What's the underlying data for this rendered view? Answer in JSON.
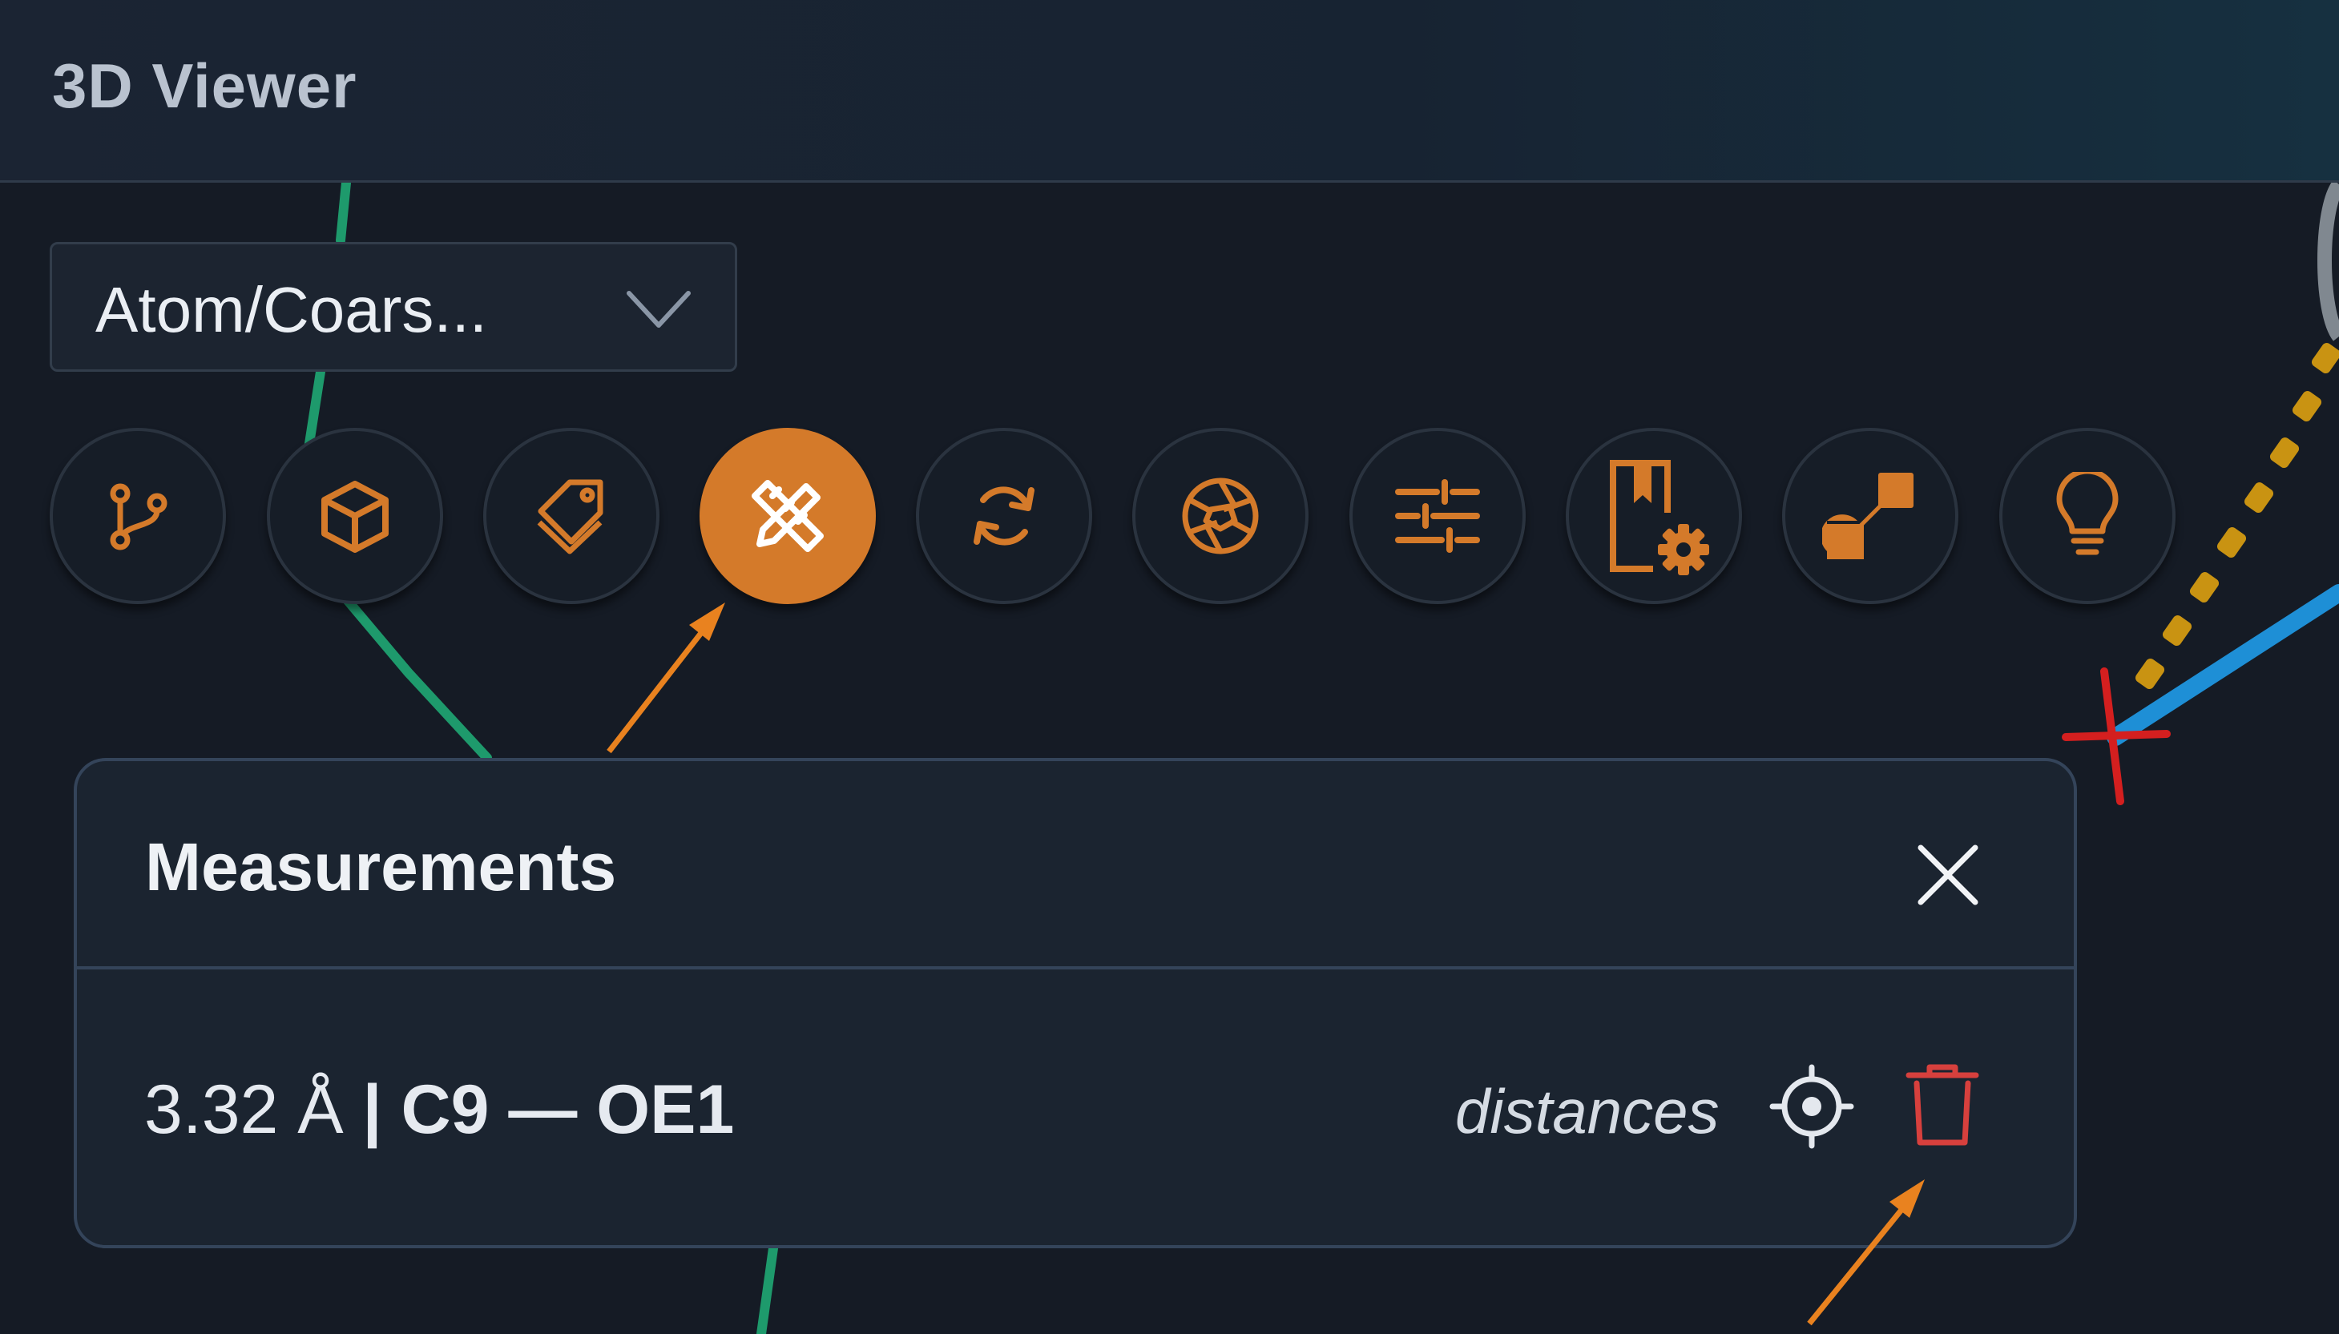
{
  "header": {
    "title": "3D Viewer"
  },
  "representation_select": {
    "value": "Atom/Coars..."
  },
  "toolbar": {
    "buttons": [
      {
        "name": "branch-icon",
        "active": false
      },
      {
        "name": "cube-icon",
        "active": false
      },
      {
        "name": "tags-icon",
        "active": false
      },
      {
        "name": "pencil-ruler-icon",
        "active": true
      },
      {
        "name": "rotate-icon",
        "active": false
      },
      {
        "name": "camera-aperture-icon",
        "active": false
      },
      {
        "name": "sliders-icon",
        "active": false
      },
      {
        "name": "bookmark-settings-icon",
        "active": false
      },
      {
        "name": "resize-diagonal-icon",
        "active": false
      },
      {
        "name": "lightbulb-icon",
        "active": false
      }
    ]
  },
  "measurements_panel": {
    "title": "Measurements",
    "rows": [
      {
        "value": "3.32 Å",
        "separator": " | ",
        "atom1": "C9",
        "dash": " — ",
        "atom2": "OE1",
        "type": "distances"
      }
    ]
  },
  "colors": {
    "accent": "#d47a2a",
    "delete": "#d7403d",
    "header_text": "#b9c2cf",
    "panel_border": "#34445a",
    "background": "#151b25"
  }
}
